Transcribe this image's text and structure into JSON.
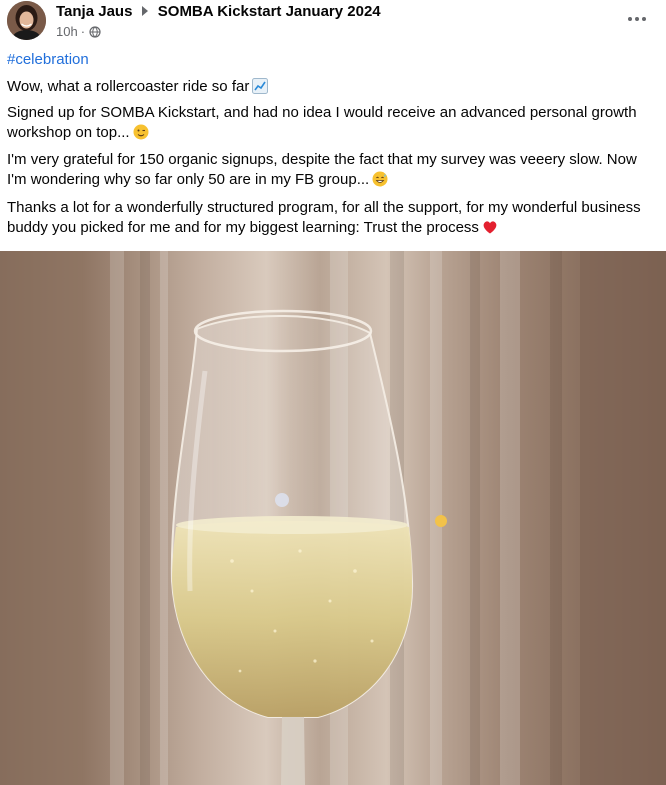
{
  "post": {
    "author": "Tanja Jaus",
    "group": "SOMBA Kickstart January 2024",
    "time": "10h",
    "privacy_icon": "globe-icon",
    "more_icon": "more-options-icon"
  },
  "content": {
    "hashtag": "#celebration",
    "paragraphs": [
      {
        "text": "Wow, what a rollercoaster ride so far",
        "emoji": "chart-increasing-emoji"
      },
      {
        "text": "Signed up for SOMBA Kickstart, and had no idea I would receive an advanced personal growth workshop on top...",
        "emoji": "winking-face-emoji"
      },
      {
        "text": "I'm very grateful for 150 organic signups, despite the fact that my survey was veeery slow. Now I'm wondering why so far only 50 are in my FB group...",
        "emoji": "grinning-sweat-emoji"
      },
      {
        "text": "Thanks a lot for a wonderfully structured program, for all the support, for my wonderful business buddy you picked for me and for my biggest learning: Trust the process",
        "emoji": "red-heart-emoji"
      }
    ]
  },
  "colors": {
    "link": "#216fdb",
    "meta": "#65676b",
    "photo_bg": "#8a7060"
  }
}
